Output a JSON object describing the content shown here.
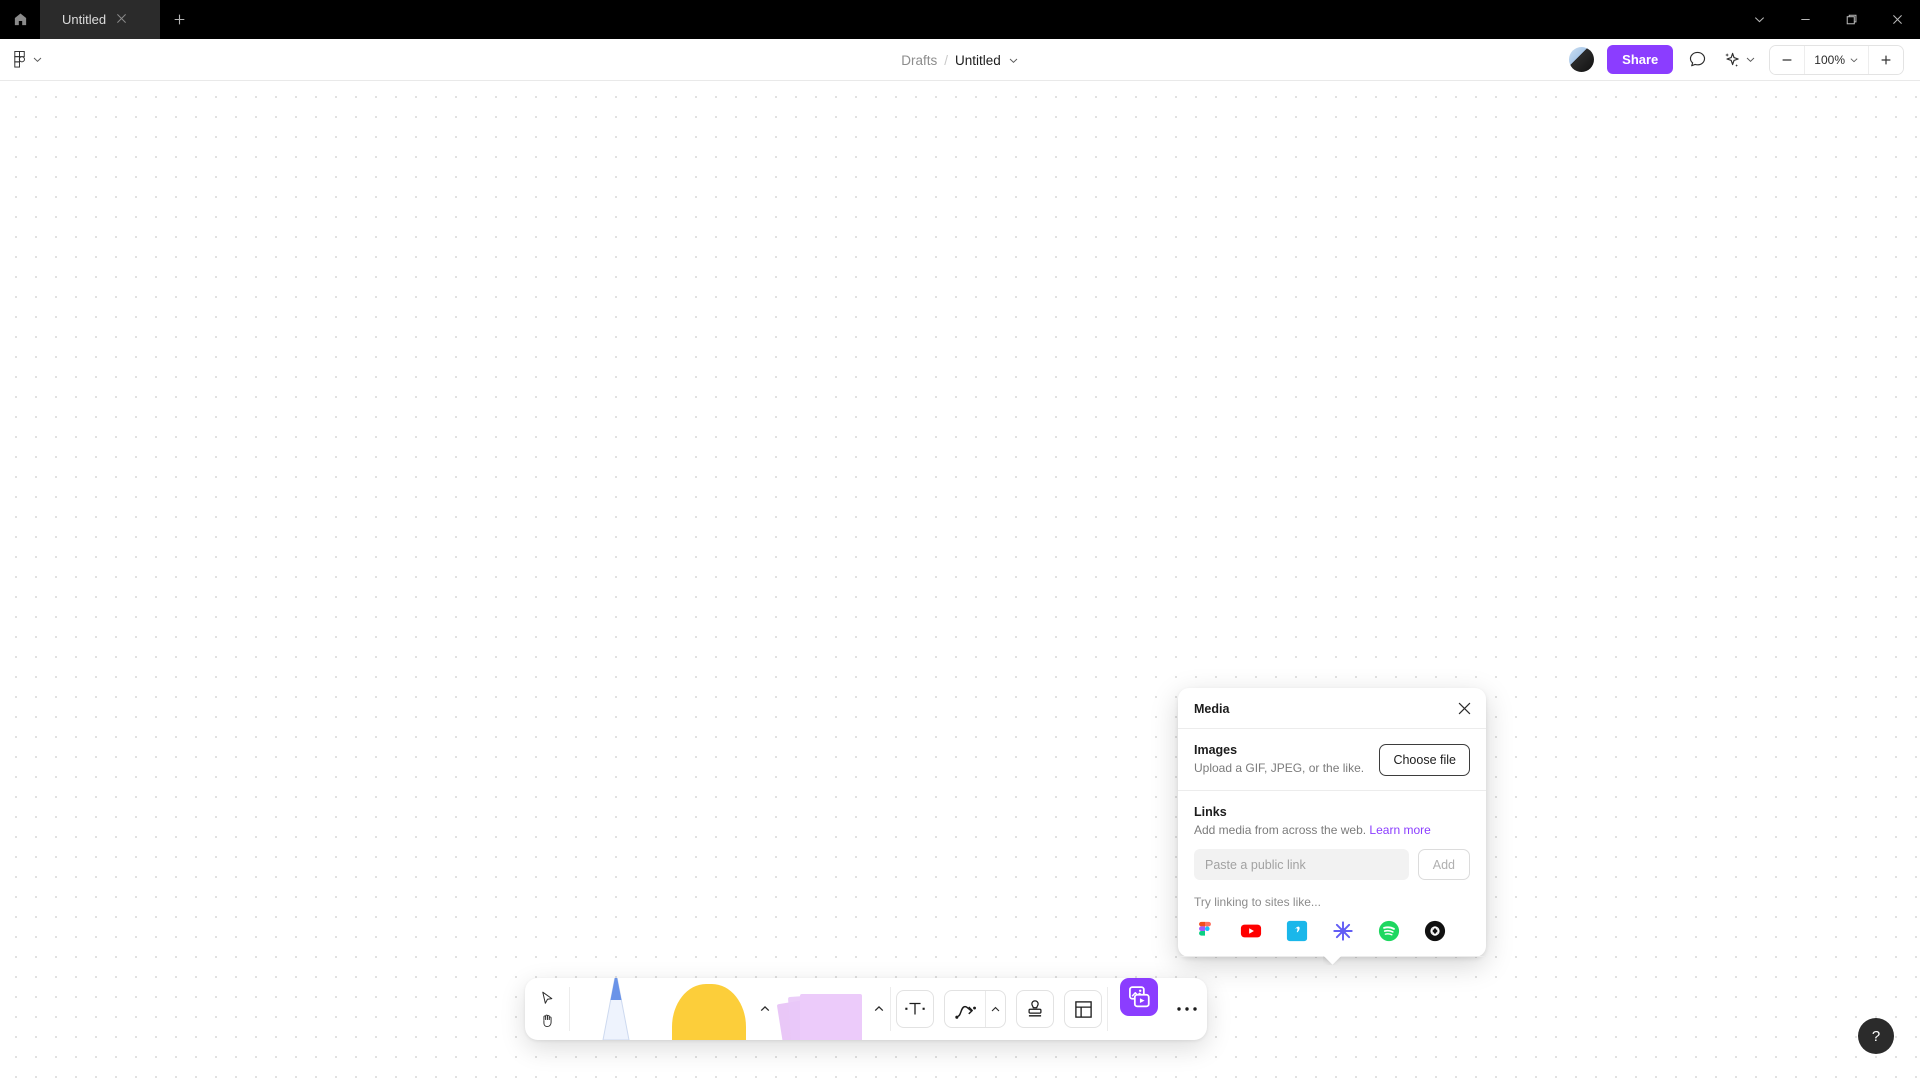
{
  "window": {
    "tab_title": "Untitled",
    "home_icon": "home-icon",
    "close_tab_icon": "close-icon",
    "new_tab_icon": "plus-icon",
    "controls": [
      "chevron-down-icon",
      "minimize-icon",
      "maximize-icon",
      "close-icon"
    ]
  },
  "appbar": {
    "menu_icon": "figma-logo-icon",
    "menu_chevron": "chevron-down-icon",
    "breadcrumb": {
      "folder": "Drafts",
      "separator": "/",
      "file": "Untitled",
      "chevron": "chevron-down-icon"
    },
    "avatar": "avatar",
    "share_label": "Share",
    "comment_icon": "comment-icon",
    "ai_icon": "sparkle-icon",
    "ai_chevron": "chevron-down-icon",
    "zoom": {
      "minus": "minus-icon",
      "value": "100%",
      "chevron": "chevron-down-icon",
      "plus": "plus-icon"
    }
  },
  "media_popover": {
    "title": "Media",
    "close_icon": "close-icon",
    "images": {
      "heading": "Images",
      "description": "Upload a GIF, JPEG, or the like.",
      "button_label": "Choose file"
    },
    "links": {
      "heading": "Links",
      "description": "Add media from across the web.",
      "learn_more": "Learn more",
      "input_placeholder": "Paste a public link",
      "input_value": "",
      "add_label": "Add",
      "try_label": "Try linking to sites like...",
      "brands": [
        {
          "name": "figma-icon",
          "label": "Figma"
        },
        {
          "name": "youtube-icon",
          "label": "YouTube"
        },
        {
          "name": "vimeo-icon",
          "label": "Vimeo"
        },
        {
          "name": "loom-icon",
          "label": "Loom"
        },
        {
          "name": "spotify-icon",
          "label": "Spotify"
        },
        {
          "name": "dribbble-icon",
          "label": "Dribbble"
        }
      ]
    }
  },
  "toolbar": {
    "cursor_icon": "cursor-arrow-icon",
    "hand_icon": "hand-icon",
    "pen_icon": "pen-tool-icon",
    "shape_icon": "shape-tool-icon",
    "shape_chevron": "chevron-up-icon",
    "sticky_icon": "sticky-note-tool-icon",
    "sticky_chevron": "chevron-up-icon",
    "text_icon": "text-tool-icon",
    "connector_icon": "connector-tool-icon",
    "connector_chevron": "chevron-up-icon",
    "stamp_icon": "stamp-tool-icon",
    "section_icon": "section-tool-icon",
    "media_icon": "media-tool-icon",
    "more_icon": "more-options-icon",
    "active_tool": "media"
  },
  "help": {
    "label": "?"
  },
  "colors": {
    "accent": "#8b3dff",
    "titlebar": "#000000",
    "tab_active": "#2b2b2b",
    "canvas_dot": "#e1e1e1",
    "sticky": "#eccbfa",
    "shape": "#fcce3a"
  }
}
